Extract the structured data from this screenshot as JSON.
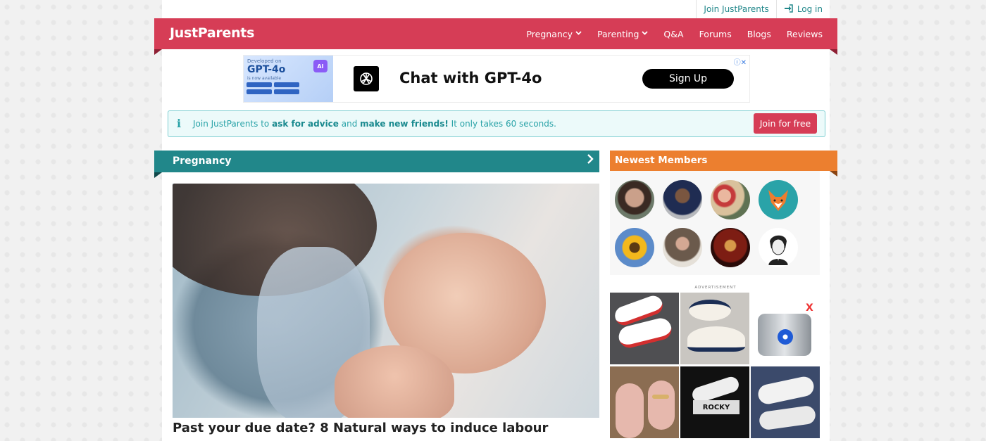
{
  "topbar": {
    "join_label": "Join JustParents",
    "login_label": "Log in"
  },
  "header": {
    "logo": "JustParents",
    "nav": [
      {
        "label": "Pregnancy",
        "has_dropdown": true
      },
      {
        "label": "Parenting",
        "has_dropdown": true
      },
      {
        "label": "Q&A",
        "has_dropdown": false
      },
      {
        "label": "Forums",
        "has_dropdown": false
      },
      {
        "label": "Blogs",
        "has_dropdown": false
      },
      {
        "label": "Reviews",
        "has_dropdown": false
      }
    ],
    "color": "#d63d56"
  },
  "ad_banner": {
    "thumb_small": "Developed on",
    "thumb_title": "GPT-4o",
    "thumb_sub": "is now available",
    "thumb_chip": "AI",
    "title": "Chat with GPT-4o",
    "button": "Sign Up",
    "choices_icon": "ⓘ✕"
  },
  "info_bar": {
    "prefix": "Join JustParents to",
    "bold1": "ask for advice",
    "mid": "and",
    "bold2": "make new friends!",
    "suffix": "It only takes 60 seconds.",
    "button": "Join for free"
  },
  "pregnancy": {
    "heading": "Pregnancy",
    "article_title": "Past your due date? 8 Natural ways to induce labour",
    "color": "#21878a"
  },
  "members": {
    "heading": "Newest Members",
    "color": "#ec7f2f",
    "avatars": [
      {
        "icon": "woman-portrait-icon"
      },
      {
        "icon": "man-suit-portrait-icon"
      },
      {
        "icon": "family-selfie-icon"
      },
      {
        "icon": "fox-avatar-icon"
      },
      {
        "icon": "sunflower-avatar-icon"
      },
      {
        "icon": "bearded-man-portrait-icon"
      },
      {
        "icon": "dark-art-avatar-icon"
      },
      {
        "icon": "sketch-man-avatar-icon"
      }
    ]
  },
  "sidebar_ad": {
    "label": "ADVERTISEMENT",
    "tiles": [
      {
        "icon": "slides-red-white-icon"
      },
      {
        "icon": "loafer-navy-white-icon"
      },
      {
        "icon": "pet-water-fountain-icon"
      },
      {
        "icon": "pink-sandal-icon"
      },
      {
        "icon": "flip-flop-box-icon"
      },
      {
        "icon": "flip-flop-white-icon"
      }
    ],
    "tile_text": "ROCKY",
    "tile_close": "X"
  }
}
